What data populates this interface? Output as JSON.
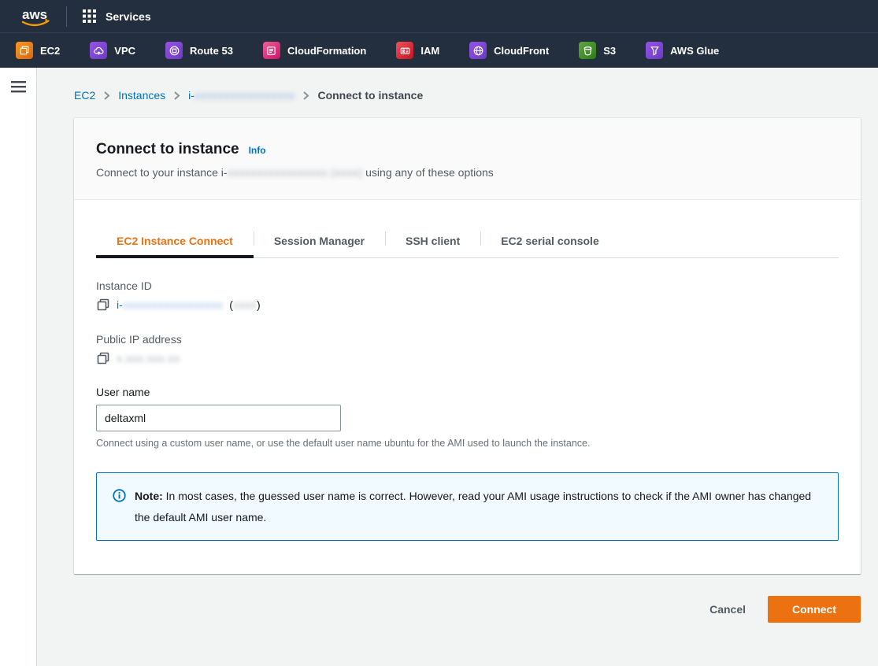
{
  "colors": {
    "nav_bg": "#232f3e",
    "accent_orange": "#ec7211",
    "link_blue": "#0073bb",
    "page_bg": "#f2f3f3",
    "note_bg": "#f1faff",
    "note_border": "#0073bb",
    "active_tab_underline": "#16191f",
    "fav_ec2": "#ec7211",
    "fav_vpc": "#7d45d4",
    "fav_route53": "#7d45d4",
    "fav_cloudformation": "#e7157b",
    "fav_iam": "#dd3445",
    "fav_cloudfront": "#7d45d4",
    "fav_s3": "#3f8624",
    "fav_glue": "#7d45d4"
  },
  "topnav": {
    "logo": "aws",
    "services": "Services"
  },
  "favorites": {
    "items": [
      {
        "label": "EC2"
      },
      {
        "label": "VPC"
      },
      {
        "label": "Route 53"
      },
      {
        "label": "CloudFormation"
      },
      {
        "label": "IAM"
      },
      {
        "label": "CloudFront"
      },
      {
        "label": "S3"
      },
      {
        "label": "AWS Glue"
      }
    ]
  },
  "breadcrumb": {
    "items": [
      "EC2",
      "Instances"
    ],
    "instance_prefix": "i-",
    "instance_redacted": "xxxxxxxxxxxxxxxxx",
    "current": "Connect to instance"
  },
  "header": {
    "title": "Connect to instance",
    "info_link": "Info",
    "subtitle_prefix": "Connect to your instance i-",
    "subtitle_redacted": "xxxxxxxxxxxxxxxxx",
    "subtitle_redacted2": "(xxxx)",
    "subtitle_suffix": "using any of these options"
  },
  "tabs": {
    "items": [
      {
        "label": "EC2 Instance Connect",
        "active": true
      },
      {
        "label": "Session Manager",
        "active": false
      },
      {
        "label": "SSH client",
        "active": false
      },
      {
        "label": "EC2 serial console",
        "active": false
      }
    ]
  },
  "panel": {
    "instance_id": {
      "label": "Instance ID",
      "prefix": "i-",
      "redacted": "xxxxxxxxxxxxxxxxx",
      "paren_open": "(",
      "redacted_name": "xxxx",
      "paren_close": ")"
    },
    "public_ip": {
      "label": "Public IP address",
      "redacted": "x.xxx.xxx.xx"
    },
    "user_name": {
      "label": "User name",
      "value": "deltaxml",
      "helper": "Connect using a custom user name, or use the default user name ubuntu for the AMI used to launch the instance."
    },
    "note": {
      "bold": "Note:",
      "text": "In most cases, the guessed user name is correct. However, read your AMI usage instructions to check if the AMI owner has changed the default AMI user name."
    }
  },
  "actions": {
    "cancel": "Cancel",
    "connect": "Connect"
  }
}
